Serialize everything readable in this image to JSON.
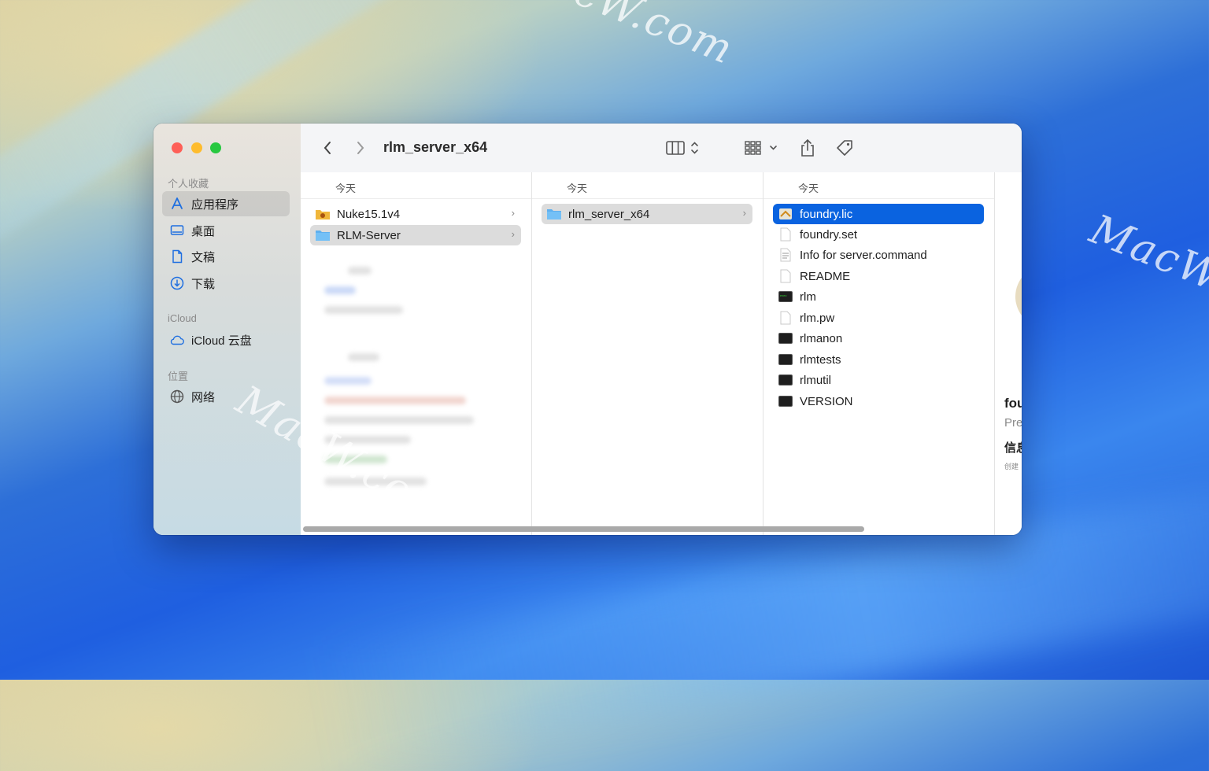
{
  "watermarks": [
    "MacW.com",
    "MacW.c",
    "MacW.com"
  ],
  "window": {
    "title": "rlm_server_x64"
  },
  "sidebar": {
    "sections": [
      {
        "label": "个人收藏",
        "items": [
          {
            "label": "应用程序",
            "icon": "apps-icon",
            "active": true
          },
          {
            "label": "桌面",
            "icon": "desktop-icon"
          },
          {
            "label": "文稿",
            "icon": "document-icon"
          },
          {
            "label": "下载",
            "icon": "download-icon"
          }
        ]
      },
      {
        "label": "iCloud",
        "items": [
          {
            "label": "iCloud 云盘",
            "icon": "cloud-icon"
          }
        ]
      },
      {
        "label": "位置",
        "items": [
          {
            "label": "网络",
            "icon": "globe-icon"
          }
        ]
      }
    ]
  },
  "columns": [
    {
      "header": "今天",
      "items": [
        {
          "name": "Nuke15.1v4",
          "type": "app-folder",
          "chevron": "›"
        },
        {
          "name": "RLM-Server",
          "type": "folder",
          "chevron": "›",
          "selected": "grey"
        }
      ]
    },
    {
      "header": "今天",
      "items": [
        {
          "name": "rlm_server_x64",
          "type": "folder",
          "chevron": "›",
          "selected": "grey"
        }
      ]
    },
    {
      "header": "今天",
      "items": [
        {
          "name": "foundry.lic",
          "type": "license",
          "selected": "blue"
        },
        {
          "name": "foundry.set",
          "type": "blank"
        },
        {
          "name": "Info for server.command",
          "type": "text"
        },
        {
          "name": "README",
          "type": "blank"
        },
        {
          "name": "rlm",
          "type": "exec"
        },
        {
          "name": "rlm.pw",
          "type": "blank"
        },
        {
          "name": "rlmanon",
          "type": "exec"
        },
        {
          "name": "rlmtests",
          "type": "exec"
        },
        {
          "name": "rlmutil",
          "type": "exec"
        },
        {
          "name": "VERSION",
          "type": "exec"
        }
      ]
    }
  ],
  "preview": {
    "name_partial": "fou",
    "kind_partial": "Pre",
    "info_partial": "信息",
    "small_partial": "创建"
  },
  "colors": {
    "selection_blue": "#0a63e0",
    "close": "#fe5f57",
    "minimize": "#febc2e",
    "zoom": "#28c840"
  }
}
